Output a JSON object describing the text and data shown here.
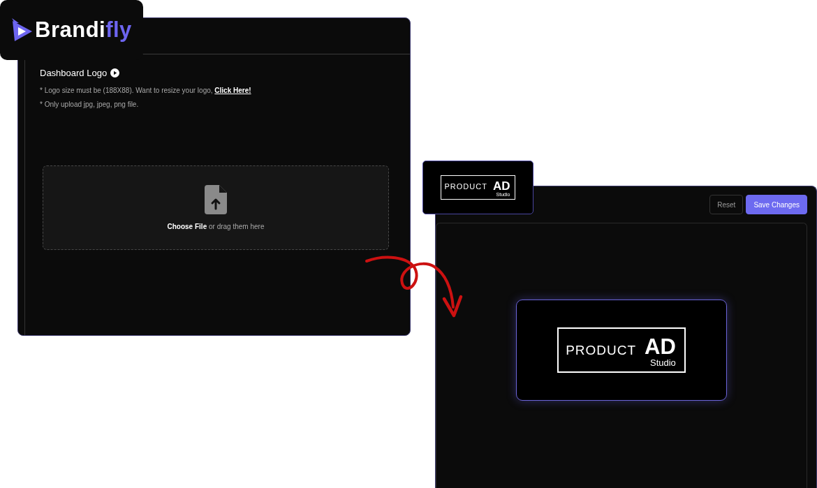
{
  "brand": {
    "name_start": "Brandi",
    "name_end": "fly"
  },
  "upload_panel": {
    "title": "Dashboard Logo",
    "notes": [
      {
        "text": "* Logo size must be (188X88). Want to resize your logo, ",
        "link": "Click Here!"
      },
      {
        "text": "* Only upload jpg, jpeg, png file."
      }
    ],
    "dropzone": {
      "action": "Choose File",
      "hint": "or drag them here"
    }
  },
  "preview_panel": {
    "thumbnail": {
      "word": "PRODUCT",
      "big_word": "AD",
      "small_word": "Studio"
    },
    "buttons": [
      {
        "label": "Reset",
        "kind": "secondary"
      },
      {
        "label": "Save Changes",
        "kind": "primary"
      }
    ],
    "preview": {
      "word": "PRODUCT",
      "big_word": "AD",
      "small_word": "Studio"
    }
  }
}
